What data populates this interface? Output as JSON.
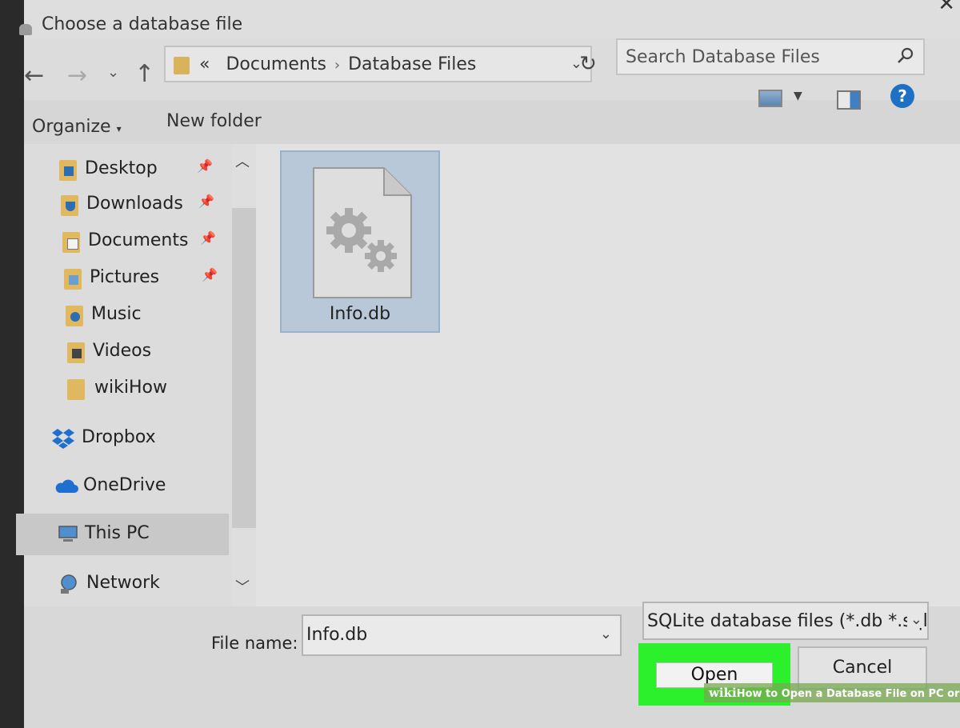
{
  "dialog": {
    "title": "Choose a database file"
  },
  "nav": {
    "back_icon": "arrow-left-icon",
    "forward_icon": "arrow-right-icon",
    "recent_icon": "chevron-down-icon",
    "up_icon": "arrow-up-icon"
  },
  "address_bar": {
    "overflow": "«",
    "crumbs": [
      "Documents",
      "Database Files"
    ]
  },
  "search": {
    "placeholder": "Search Database Files"
  },
  "toolbar": {
    "organize_label": "Organize",
    "new_folder_label": "New folder",
    "help_label": "?"
  },
  "sidebar": {
    "items": [
      {
        "label": "Desktop",
        "icon": "desktop-folder-icon",
        "pinned": true
      },
      {
        "label": "Downloads",
        "icon": "downloads-folder-icon",
        "pinned": true
      },
      {
        "label": "Documents",
        "icon": "documents-folder-icon",
        "pinned": true
      },
      {
        "label": "Pictures",
        "icon": "pictures-folder-icon",
        "pinned": true
      },
      {
        "label": "Music",
        "icon": "music-folder-icon",
        "pinned": false
      },
      {
        "label": "Videos",
        "icon": "videos-folder-icon",
        "pinned": false
      },
      {
        "label": "wikiHow",
        "icon": "folder-icon",
        "pinned": false
      },
      {
        "label": "Dropbox",
        "icon": "dropbox-icon",
        "pinned": false
      },
      {
        "label": "OneDrive",
        "icon": "onedrive-icon",
        "pinned": false
      },
      {
        "label": "This PC",
        "icon": "computer-icon",
        "pinned": false,
        "selected": true
      },
      {
        "label": "Network",
        "icon": "network-icon",
        "pinned": false
      }
    ]
  },
  "files": [
    {
      "name": "Info.db",
      "icon": "settings-file-icon",
      "selected": true
    }
  ],
  "bottom": {
    "file_name_label": "File name:",
    "file_name_value": "Info.db",
    "file_type": "SQLite database files (*.db *.sql",
    "open_label": "Open",
    "cancel_label": "Cancel"
  },
  "watermark": {
    "brand": "wiki",
    "text": "How to Open a Database File on PC or Mac"
  },
  "colors": {
    "highlight": "#2cf02c",
    "selection": "#b8c8d8",
    "folder": "#e0b860",
    "help_blue": "#1f6fc5"
  }
}
